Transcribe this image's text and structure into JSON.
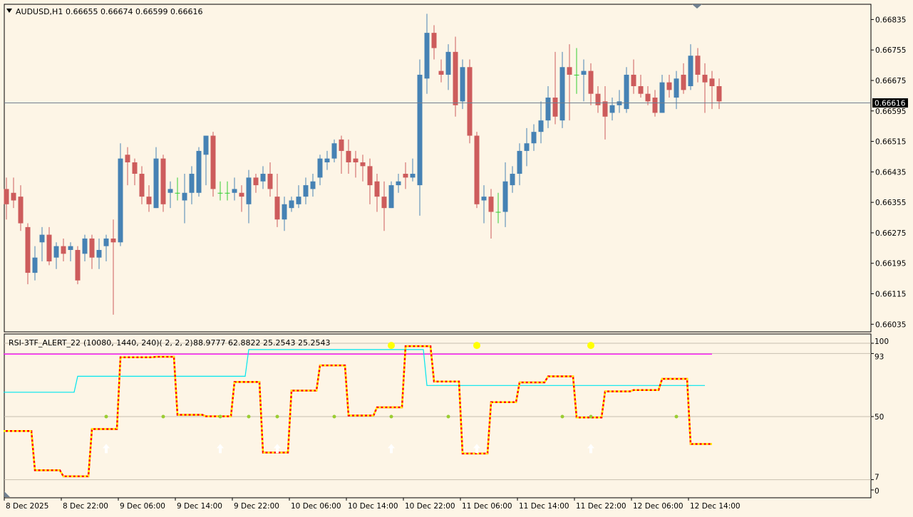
{
  "main_header": {
    "symbol_label": "AUDUSD,H1",
    "ohlc_values": "0.66655 0.66674 0.66599 0.66616"
  },
  "price_axis": {
    "ticks": [
      "0.66835",
      "0.66755",
      "0.66675",
      "0.66595",
      "0.66515",
      "0.66435",
      "0.66355",
      "0.66275",
      "0.66195",
      "0.66115",
      "0.66035"
    ],
    "current_price": "0.66616"
  },
  "indicator_header": {
    "name": "RSI-3TF_ALERT_22",
    "params": "(10080, 1440, 240)( 2, 2, 2)",
    "values": "88.9777 62.8822 25.2543 25.2543"
  },
  "indicator_axis": {
    "ticks": [
      "100",
      "93",
      "50",
      "7",
      "0"
    ]
  },
  "time_axis": {
    "labels": [
      "8 Dec 2025",
      "8 Dec 22:00",
      "9 Dec 06:00",
      "9 Dec 14:00",
      "9 Dec 22:00",
      "10 Dec 06:00",
      "10 Dec 14:00",
      "10 Dec 22:00",
      "11 Dec 06:00",
      "11 Dec 14:00",
      "11 Dec 22:00",
      "12 Dec 06:00",
      "12 Dec 14:00"
    ]
  },
  "colors": {
    "background": "#fdf5e6",
    "bull_candle": "#4682b4",
    "bear_candle": "#cd5c5c",
    "doji_candle": "#32cd32",
    "price_line": "#708090",
    "rsi_line": "#ff0000",
    "rsi_dash": "#ffff00",
    "weekly_line": "#ff00ff",
    "daily_line": "#00e5ee",
    "signal_dot": "#ffff00",
    "midline_dot": "#9acd32"
  },
  "chart_data": [
    {
      "type": "candlestick",
      "title": "AUDUSD,H1",
      "ylim": [
        0.66015,
        0.66875
      ],
      "candles": [
        {
          "o": 0.6639,
          "h": 0.6642,
          "l": 0.6631,
          "c": 0.6635
        },
        {
          "o": 0.6638,
          "h": 0.6642,
          "l": 0.6634,
          "c": 0.6636
        },
        {
          "o": 0.6637,
          "h": 0.664,
          "l": 0.6628,
          "c": 0.663
        },
        {
          "o": 0.6629,
          "h": 0.663,
          "l": 0.6614,
          "c": 0.6617
        },
        {
          "o": 0.6617,
          "h": 0.6624,
          "l": 0.6615,
          "c": 0.6621
        },
        {
          "o": 0.6625,
          "h": 0.6629,
          "l": 0.662,
          "c": 0.6627
        },
        {
          "o": 0.6627,
          "h": 0.6629,
          "l": 0.6619,
          "c": 0.662
        },
        {
          "o": 0.6621,
          "h": 0.6625,
          "l": 0.6618,
          "c": 0.6624
        },
        {
          "o": 0.6624,
          "h": 0.6626,
          "l": 0.662,
          "c": 0.6622
        },
        {
          "o": 0.6623,
          "h": 0.6625,
          "l": 0.662,
          "c": 0.6624
        },
        {
          "o": 0.6623,
          "h": 0.6624,
          "l": 0.6614,
          "c": 0.6615
        },
        {
          "o": 0.6622,
          "h": 0.6627,
          "l": 0.662,
          "c": 0.6626
        },
        {
          "o": 0.6626,
          "h": 0.6627,
          "l": 0.6618,
          "c": 0.6621
        },
        {
          "o": 0.6621,
          "h": 0.6626,
          "l": 0.6618,
          "c": 0.6623
        },
        {
          "o": 0.6624,
          "h": 0.6627,
          "l": 0.662,
          "c": 0.6626
        },
        {
          "o": 0.6626,
          "h": 0.6631,
          "l": 0.6606,
          "c": 0.6625
        },
        {
          "o": 0.6625,
          "h": 0.6651,
          "l": 0.6624,
          "c": 0.6647
        },
        {
          "o": 0.6648,
          "h": 0.665,
          "l": 0.664,
          "c": 0.6646
        },
        {
          "o": 0.6646,
          "h": 0.6647,
          "l": 0.664,
          "c": 0.6643
        },
        {
          "o": 0.6643,
          "h": 0.6645,
          "l": 0.6635,
          "c": 0.6637
        },
        {
          "o": 0.6637,
          "h": 0.664,
          "l": 0.6633,
          "c": 0.6635
        },
        {
          "o": 0.6634,
          "h": 0.665,
          "l": 0.6634,
          "c": 0.6647
        },
        {
          "o": 0.6647,
          "h": 0.6648,
          "l": 0.6633,
          "c": 0.6635
        },
        {
          "o": 0.6638,
          "h": 0.6641,
          "l": 0.6634,
          "c": 0.6639
        },
        {
          "o": 0.6638,
          "h": 0.6642,
          "l": 0.6636,
          "c": 0.6638
        },
        {
          "o": 0.6636,
          "h": 0.6643,
          "l": 0.663,
          "c": 0.6638
        },
        {
          "o": 0.6638,
          "h": 0.6645,
          "l": 0.6635,
          "c": 0.6643
        },
        {
          "o": 0.6638,
          "h": 0.665,
          "l": 0.6637,
          "c": 0.6649
        },
        {
          "o": 0.6648,
          "h": 0.6653,
          "l": 0.664,
          "c": 0.6653
        },
        {
          "o": 0.6653,
          "h": 0.6654,
          "l": 0.6637,
          "c": 0.6639
        },
        {
          "o": 0.6638,
          "h": 0.6641,
          "l": 0.6636,
          "c": 0.6638
        },
        {
          "o": 0.6638,
          "h": 0.6641,
          "l": 0.6636,
          "c": 0.6638
        },
        {
          "o": 0.6638,
          "h": 0.6642,
          "l": 0.6636,
          "c": 0.6639
        },
        {
          "o": 0.6638,
          "h": 0.664,
          "l": 0.6633,
          "c": 0.6637
        },
        {
          "o": 0.6635,
          "h": 0.6644,
          "l": 0.663,
          "c": 0.6642
        },
        {
          "o": 0.6642,
          "h": 0.6643,
          "l": 0.6638,
          "c": 0.664
        },
        {
          "o": 0.6641,
          "h": 0.6645,
          "l": 0.6639,
          "c": 0.6643
        },
        {
          "o": 0.6643,
          "h": 0.6646,
          "l": 0.6637,
          "c": 0.6639
        },
        {
          "o": 0.6637,
          "h": 0.6643,
          "l": 0.6629,
          "c": 0.6631
        },
        {
          "o": 0.6631,
          "h": 0.6637,
          "l": 0.6628,
          "c": 0.6635
        },
        {
          "o": 0.6634,
          "h": 0.6637,
          "l": 0.6633,
          "c": 0.6636
        },
        {
          "o": 0.6635,
          "h": 0.664,
          "l": 0.6634,
          "c": 0.6637
        },
        {
          "o": 0.6637,
          "h": 0.6642,
          "l": 0.6635,
          "c": 0.664
        },
        {
          "o": 0.6639,
          "h": 0.6643,
          "l": 0.6637,
          "c": 0.6641
        },
        {
          "o": 0.6642,
          "h": 0.6648,
          "l": 0.664,
          "c": 0.6647
        },
        {
          "o": 0.6646,
          "h": 0.6649,
          "l": 0.6644,
          "c": 0.6647
        },
        {
          "o": 0.6647,
          "h": 0.6652,
          "l": 0.6646,
          "c": 0.6651
        },
        {
          "o": 0.6652,
          "h": 0.6653,
          "l": 0.6643,
          "c": 0.6649
        },
        {
          "o": 0.6649,
          "h": 0.6652,
          "l": 0.6643,
          "c": 0.6646
        },
        {
          "o": 0.6647,
          "h": 0.6649,
          "l": 0.6642,
          "c": 0.6646
        },
        {
          "o": 0.6646,
          "h": 0.6648,
          "l": 0.6641,
          "c": 0.6645
        },
        {
          "o": 0.6645,
          "h": 0.6647,
          "l": 0.6635,
          "c": 0.664
        },
        {
          "o": 0.6641,
          "h": 0.6643,
          "l": 0.6633,
          "c": 0.6637
        },
        {
          "o": 0.6637,
          "h": 0.6641,
          "l": 0.6628,
          "c": 0.6634
        },
        {
          "o": 0.6634,
          "h": 0.6641,
          "l": 0.6634,
          "c": 0.664
        },
        {
          "o": 0.664,
          "h": 0.6643,
          "l": 0.6638,
          "c": 0.6641
        },
        {
          "o": 0.6643,
          "h": 0.6646,
          "l": 0.6639,
          "c": 0.6642
        },
        {
          "o": 0.6642,
          "h": 0.6647,
          "l": 0.6641,
          "c": 0.6643
        },
        {
          "o": 0.664,
          "h": 0.6673,
          "l": 0.6632,
          "c": 0.6669
        },
        {
          "o": 0.6668,
          "h": 0.6685,
          "l": 0.6664,
          "c": 0.668
        },
        {
          "o": 0.668,
          "h": 0.6682,
          "l": 0.6673,
          "c": 0.6676
        },
        {
          "o": 0.667,
          "h": 0.6673,
          "l": 0.6667,
          "c": 0.6669
        },
        {
          "o": 0.6669,
          "h": 0.6677,
          "l": 0.6665,
          "c": 0.6675
        },
        {
          "o": 0.6675,
          "h": 0.6679,
          "l": 0.6658,
          "c": 0.6661
        },
        {
          "o": 0.6662,
          "h": 0.6673,
          "l": 0.666,
          "c": 0.6671
        },
        {
          "o": 0.6671,
          "h": 0.6673,
          "l": 0.6651,
          "c": 0.6653
        },
        {
          "o": 0.6653,
          "h": 0.6654,
          "l": 0.6634,
          "c": 0.6635
        },
        {
          "o": 0.6636,
          "h": 0.664,
          "l": 0.663,
          "c": 0.6637
        },
        {
          "o": 0.6637,
          "h": 0.6639,
          "l": 0.6626,
          "c": 0.6633
        },
        {
          "o": 0.6633,
          "h": 0.6638,
          "l": 0.663,
          "c": 0.6633
        },
        {
          "o": 0.6633,
          "h": 0.6646,
          "l": 0.6629,
          "c": 0.6641
        },
        {
          "o": 0.664,
          "h": 0.6645,
          "l": 0.6638,
          "c": 0.6643
        },
        {
          "o": 0.6643,
          "h": 0.6651,
          "l": 0.664,
          "c": 0.6649
        },
        {
          "o": 0.6649,
          "h": 0.6655,
          "l": 0.6645,
          "c": 0.6651
        },
        {
          "o": 0.6651,
          "h": 0.6656,
          "l": 0.6649,
          "c": 0.6654
        },
        {
          "o": 0.6654,
          "h": 0.6662,
          "l": 0.6651,
          "c": 0.6657
        },
        {
          "o": 0.6657,
          "h": 0.6666,
          "l": 0.6655,
          "c": 0.6663
        },
        {
          "o": 0.6663,
          "h": 0.6675,
          "l": 0.6656,
          "c": 0.6658
        },
        {
          "o": 0.6657,
          "h": 0.6675,
          "l": 0.6655,
          "c": 0.6671
        },
        {
          "o": 0.6671,
          "h": 0.6677,
          "l": 0.6657,
          "c": 0.6669
        },
        {
          "o": 0.6669,
          "h": 0.6676,
          "l": 0.6664,
          "c": 0.6669
        },
        {
          "o": 0.6669,
          "h": 0.6673,
          "l": 0.6662,
          "c": 0.667
        },
        {
          "o": 0.667,
          "h": 0.6672,
          "l": 0.6661,
          "c": 0.6664
        },
        {
          "o": 0.6664,
          "h": 0.6666,
          "l": 0.6659,
          "c": 0.6661
        },
        {
          "o": 0.6662,
          "h": 0.6666,
          "l": 0.6652,
          "c": 0.6658
        },
        {
          "o": 0.6659,
          "h": 0.6663,
          "l": 0.6657,
          "c": 0.6661
        },
        {
          "o": 0.6661,
          "h": 0.6665,
          "l": 0.6659,
          "c": 0.6662
        },
        {
          "o": 0.666,
          "h": 0.6671,
          "l": 0.6659,
          "c": 0.6669
        },
        {
          "o": 0.6669,
          "h": 0.6673,
          "l": 0.6664,
          "c": 0.6666
        },
        {
          "o": 0.6666,
          "h": 0.6669,
          "l": 0.6663,
          "c": 0.6664
        },
        {
          "o": 0.6664,
          "h": 0.6666,
          "l": 0.6661,
          "c": 0.6662
        },
        {
          "o": 0.6663,
          "h": 0.6665,
          "l": 0.6658,
          "c": 0.6659
        },
        {
          "o": 0.6659,
          "h": 0.6669,
          "l": 0.6659,
          "c": 0.6667
        },
        {
          "o": 0.6667,
          "h": 0.6669,
          "l": 0.6663,
          "c": 0.6665
        },
        {
          "o": 0.6663,
          "h": 0.667,
          "l": 0.666,
          "c": 0.6668
        },
        {
          "o": 0.6669,
          "h": 0.6672,
          "l": 0.6664,
          "c": 0.6665
        },
        {
          "o": 0.6666,
          "h": 0.6677,
          "l": 0.6665,
          "c": 0.6674
        },
        {
          "o": 0.6674,
          "h": 0.6676,
          "l": 0.6667,
          "c": 0.6669
        },
        {
          "o": 0.6669,
          "h": 0.6672,
          "l": 0.6659,
          "c": 0.6667
        },
        {
          "o": 0.6668,
          "h": 0.667,
          "l": 0.666,
          "c": 0.6666
        },
        {
          "o": 0.6666,
          "h": 0.6668,
          "l": 0.666,
          "c": 0.6662
        }
      ]
    },
    {
      "type": "line",
      "title": "RSI-3TF_ALERT_22",
      "ylim": [
        0,
        100
      ],
      "levels": [
        93,
        50,
        7
      ],
      "series": [
        {
          "values": [
            40.2,
            40.2,
            40.2,
            40.2,
            13.4,
            13.4,
            13.4,
            13.4,
            9.3,
            9.3,
            9.3,
            9.3,
            41.5,
            41.5,
            41.5,
            41.5,
            90.4,
            90.4,
            90.4,
            90.4,
            90.4,
            90.8,
            90.8,
            90.8,
            51.2,
            51.2,
            51.2,
            51.2,
            50.2,
            50.2,
            50.2,
            50.2,
            73.6,
            73.6,
            73.6,
            73.6,
            25.5,
            25.5,
            25.5,
            25.5,
            67.7,
            67.7,
            67.7,
            67.7,
            84.9,
            84.9,
            84.9,
            84.9,
            50.7,
            50.7,
            50.7,
            50.7,
            56.3,
            56.3,
            56.3,
            56.3,
            98.0,
            98.0,
            98.0,
            98.0,
            73.9,
            73.9,
            73.9,
            73.9,
            24.8,
            24.8,
            24.8,
            24.8,
            59.8,
            59.8,
            59.8,
            59.8,
            73.3,
            73.3,
            73.3,
            73.3,
            77.4,
            77.4,
            77.4,
            77.4,
            49.4,
            49.4,
            49.4,
            49.4,
            67.2,
            67.2,
            67.2,
            67.2,
            68.1,
            68.1,
            68.1,
            68.1,
            75.7,
            75.7,
            75.7,
            75.7,
            31.3,
            31.3,
            31.3,
            31.3
          ]
        },
        {
          "values": [
            92.6,
            92.6,
            92.6,
            92.6,
            92.6,
            92.6,
            92.6,
            92.6,
            92.6,
            92.6,
            92.6,
            92.6,
            92.6,
            92.6,
            92.6,
            92.6,
            92.6,
            92.6,
            92.6,
            92.6,
            92.6,
            92.6,
            92.6,
            92.6,
            92.6,
            92.6,
            92.6,
            92.6,
            92.6,
            92.6,
            92.6,
            92.6,
            92.6,
            92.6,
            92.6,
            92.6,
            92.6,
            92.6,
            92.6,
            92.6,
            92.6,
            92.6,
            92.6,
            92.6,
            92.6,
            92.6,
            92.6,
            92.6,
            92.6,
            92.6,
            92.6,
            92.6,
            92.6,
            92.6,
            92.6,
            92.6,
            92.6,
            92.6,
            92.6,
            92.6,
            92.6,
            92.6,
            92.6,
            92.6,
            92.6,
            92.6,
            92.6,
            92.6,
            92.6,
            92.6,
            92.6,
            92.6,
            92.6,
            92.6,
            92.6,
            92.6,
            92.6,
            92.6,
            92.6,
            92.6,
            92.6,
            92.6,
            92.6,
            92.6,
            92.6,
            92.6,
            92.6,
            92.6,
            92.6,
            92.6,
            92.6,
            92.6,
            92.6,
            92.6,
            92.6,
            92.6,
            92.6,
            92.6,
            92.6,
            92.6
          ]
        },
        {
          "values": [
            66.6,
            66.6,
            66.6,
            66.6,
            66.6,
            66.6,
            66.6,
            66.6,
            66.6,
            66.6,
            77.5,
            77.5,
            77.5,
            77.5,
            77.5,
            77.5,
            77.5,
            77.5,
            77.5,
            77.5,
            77.5,
            77.5,
            77.5,
            77.5,
            77.5,
            77.5,
            77.5,
            77.5,
            77.5,
            77.5,
            77.5,
            77.5,
            77.5,
            77.5,
            95.7,
            95.7,
            95.7,
            95.7,
            95.7,
            95.7,
            95.7,
            95.7,
            95.7,
            95.7,
            95.7,
            95.7,
            95.7,
            95.7,
            95.7,
            95.7,
            95.7,
            95.7,
            95.7,
            95.7,
            95.7,
            95.7,
            95.7,
            95.7,
            95.7,
            71.2,
            71.2,
            71.2,
            71.2,
            71.2,
            71.2,
            71.2,
            71.2,
            71.2,
            71.2,
            71.2,
            71.2,
            71.2,
            71.2,
            71.2,
            71.2,
            71.2,
            71.2,
            71.2,
            71.2,
            71.2,
            71.2,
            71.2,
            71.2,
            71.2,
            71.2,
            71.2,
            71.2,
            71.2,
            71.2,
            71.2,
            71.2,
            71.2,
            71.2,
            71.2,
            71.2,
            71.2,
            71.2,
            71.2,
            71.2
          ]
        }
      ]
    }
  ]
}
